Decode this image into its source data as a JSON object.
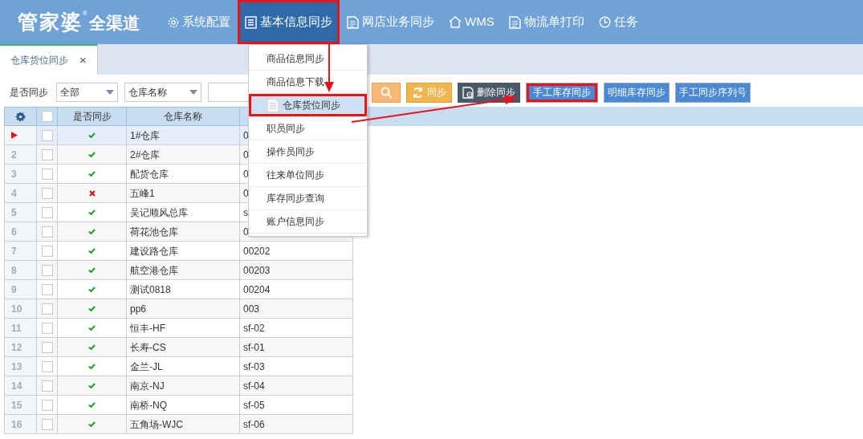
{
  "logo": {
    "brand": "管家婆",
    "mark": "®",
    "product": "全渠道"
  },
  "nav": [
    {
      "kind": "gear",
      "label": "系统配置",
      "selected": false,
      "highlighted": false
    },
    {
      "kind": "list",
      "label": "基本信息同步",
      "selected": true,
      "highlighted": true
    },
    {
      "kind": "doc",
      "label": "网店业务同步",
      "selected": false,
      "highlighted": false
    },
    {
      "kind": "house",
      "label": "WMS",
      "selected": false,
      "highlighted": false
    },
    {
      "kind": "doc",
      "label": "物流单打印",
      "selected": false,
      "highlighted": false
    },
    {
      "kind": "clock",
      "label": "任务",
      "selected": false,
      "highlighted": false
    }
  ],
  "menu": [
    {
      "label": "商品信息同步",
      "selected": false,
      "highlighted": false
    },
    {
      "label": "商品信息下载",
      "selected": false,
      "highlighted": false
    },
    {
      "label": "仓库货位同步",
      "selected": true,
      "highlighted": true
    },
    {
      "label": "职员同步",
      "selected": false,
      "highlighted": false
    },
    {
      "label": "操作员同步",
      "selected": false,
      "highlighted": false
    },
    {
      "label": "往来单位同步",
      "selected": false,
      "highlighted": false
    },
    {
      "label": "库存同步查询",
      "selected": false,
      "highlighted": false
    },
    {
      "label": "账户信息同步",
      "selected": false,
      "highlighted": false
    }
  ],
  "tabs": [
    {
      "label": "仓库货位同步",
      "close": "×",
      "selected": true
    }
  ],
  "filter": {
    "label": "是否同步",
    "status_select": "全部",
    "field_select": "仓库名称"
  },
  "buttons": [
    {
      "kind": "search",
      "highlighted": false
    },
    {
      "kind": "sync",
      "label": "同步",
      "highlighted": false
    },
    {
      "kind": "delete",
      "label": "删除同步",
      "highlighted": false
    },
    {
      "kind": "primary",
      "label": "手工库存同步",
      "highlighted": true
    },
    {
      "kind": "primary",
      "label": "明细库存同步",
      "highlighted": false
    },
    {
      "kind": "primary",
      "label": "手工同步序列号",
      "highlighted": false
    }
  ],
  "table": {
    "columns": [
      "是否同步",
      "仓库名称"
    ],
    "header_checked": false,
    "rows": [
      {
        "number": "",
        "selected": true,
        "checked": false,
        "synced": true,
        "name": "1#仓库",
        "column_3": "0"
      },
      {
        "number": "2",
        "selected": false,
        "checked": false,
        "synced": true,
        "name": "2#仓库",
        "column_3": "0"
      },
      {
        "number": "3",
        "selected": false,
        "checked": false,
        "synced": true,
        "name": "配货仓库",
        "column_3": "0"
      },
      {
        "number": "4",
        "selected": false,
        "checked": false,
        "synced": false,
        "name": "五峰1",
        "column_3": "0"
      },
      {
        "number": "5",
        "selected": false,
        "checked": false,
        "synced": true,
        "name": "吴记顺风总库",
        "column_3": "s"
      },
      {
        "number": "6",
        "selected": false,
        "checked": false,
        "synced": true,
        "name": "荷花池仓库",
        "column_3": "0"
      },
      {
        "number": "7",
        "selected": false,
        "checked": false,
        "synced": true,
        "name": "建设路仓库",
        "column_3": "00202"
      },
      {
        "number": "8",
        "selected": false,
        "checked": false,
        "synced": true,
        "name": "航空港仓库",
        "column_3": "00203"
      },
      {
        "number": "9",
        "selected": false,
        "checked": false,
        "synced": true,
        "name": "测试0818",
        "column_3": "00204"
      },
      {
        "number": "10",
        "selected": false,
        "checked": false,
        "synced": true,
        "name": "pp6",
        "column_3": "003"
      },
      {
        "number": "11",
        "selected": false,
        "checked": false,
        "synced": true,
        "name": "恒丰-HF",
        "column_3": "sf-02"
      },
      {
        "number": "12",
        "selected": false,
        "checked": false,
        "synced": true,
        "name": "长寿-CS",
        "column_3": "sf-01"
      },
      {
        "number": "13",
        "selected": false,
        "checked": false,
        "synced": true,
        "name": "金兰-JL",
        "column_3": "sf-03"
      },
      {
        "number": "14",
        "selected": false,
        "checked": false,
        "synced": true,
        "name": "南京-NJ",
        "column_3": "sf-04"
      },
      {
        "number": "15",
        "selected": false,
        "checked": false,
        "synced": true,
        "name": "南桥-NQ",
        "column_3": "sf-05"
      },
      {
        "number": "16",
        "selected": false,
        "checked": false,
        "synced": true,
        "name": "五角场-WJC",
        "column_3": "sf-06"
      }
    ]
  }
}
